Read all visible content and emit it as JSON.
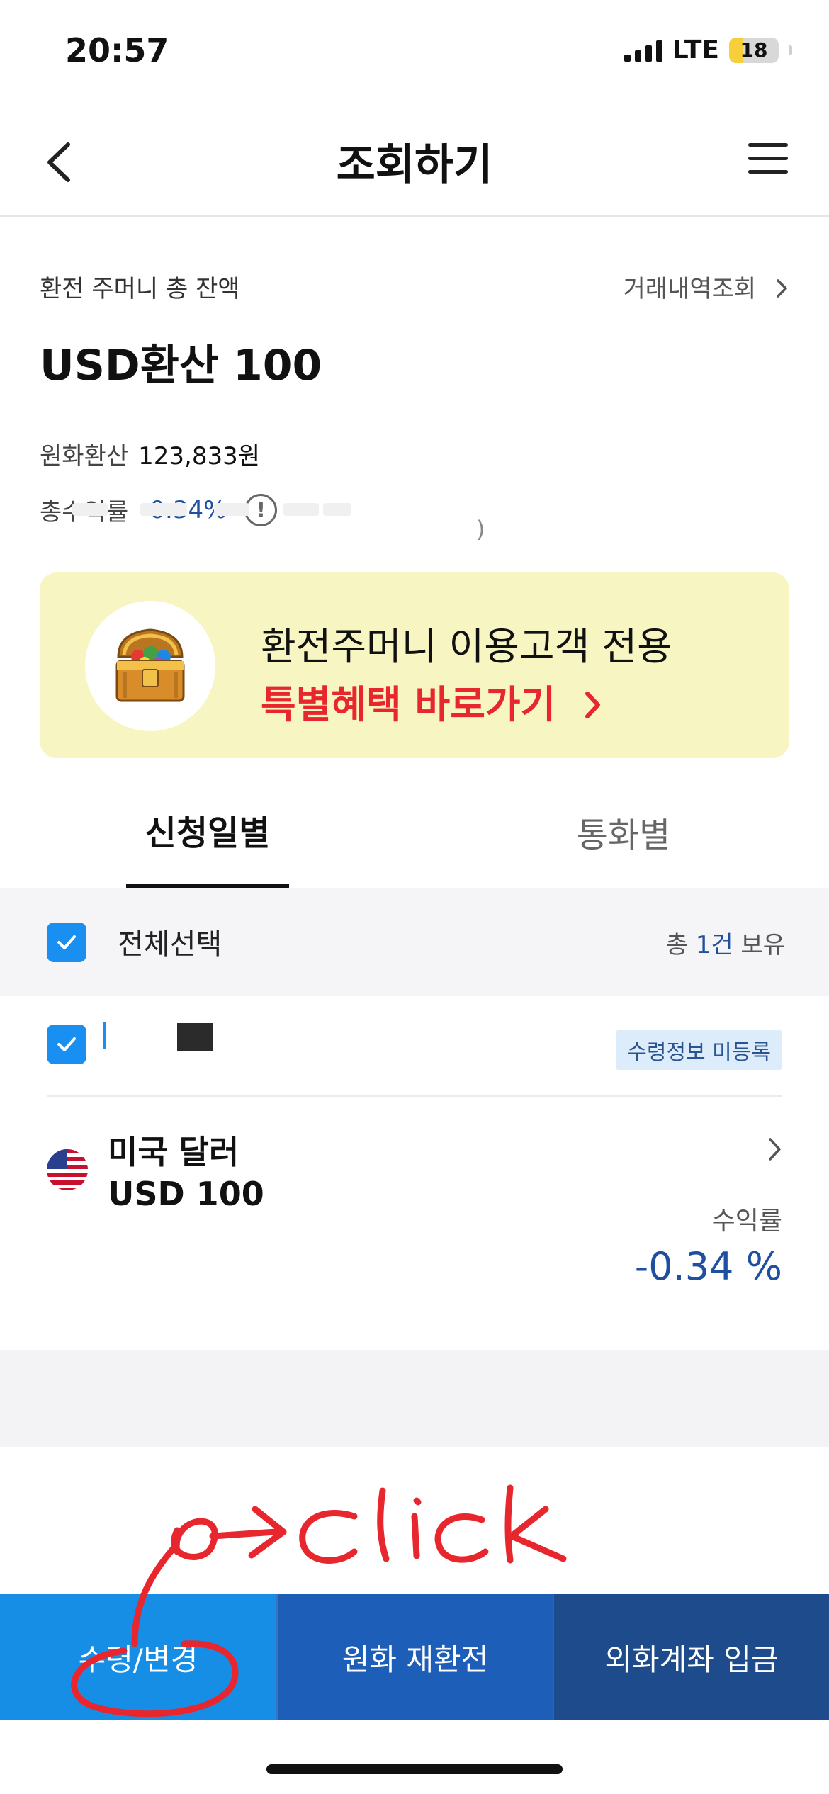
{
  "status_bar": {
    "time": "20:57",
    "network": "LTE",
    "battery": "18",
    "battery_level": 0.18
  },
  "nav": {
    "title": "조회하기",
    "back_icon": "chevron-left-icon",
    "menu_icon": "hamburger-menu-icon"
  },
  "balance": {
    "label": "환전 주머니 총 잔액",
    "history_link": "거래내역조회",
    "amount": "USD환산 100",
    "krw_label": "원화환산",
    "krw_value": "123,833원",
    "return_label": "총수익률",
    "return_value": "-0.34%",
    "info_icon": "!",
    "partial_text": ")"
  },
  "promo": {
    "line1": "환전주머니 이용고객 전용",
    "line2": "특별혜택 바로가기",
    "line2_arrow": "›"
  },
  "tabs": [
    {
      "label": "신청일별",
      "active": true
    },
    {
      "label": "통화별",
      "active": false
    }
  ],
  "list_header": {
    "select_all": "전체선택",
    "holdings_prefix": "총 ",
    "holdings_count": "1건",
    "holdings_suffix": " 보유"
  },
  "item": {
    "status_badge": "수령정보 미등록",
    "currency_name": "미국 달러",
    "currency_amount": "USD 100",
    "rate_label": "수익률",
    "rate_value": "-0.34 %"
  },
  "annotation": {
    "text": "click",
    "color": "#e8262e"
  },
  "bottom_bar": {
    "receive": "수령/변경",
    "reexchange": "원화 재환전",
    "deposit": "외화계좌 입금"
  },
  "colors": {
    "accent_blue": "#1a8ff2",
    "negative_rate": "#1f4fa0",
    "promo_bg": "#f7f5c2",
    "promo_red": "#e8262e"
  }
}
